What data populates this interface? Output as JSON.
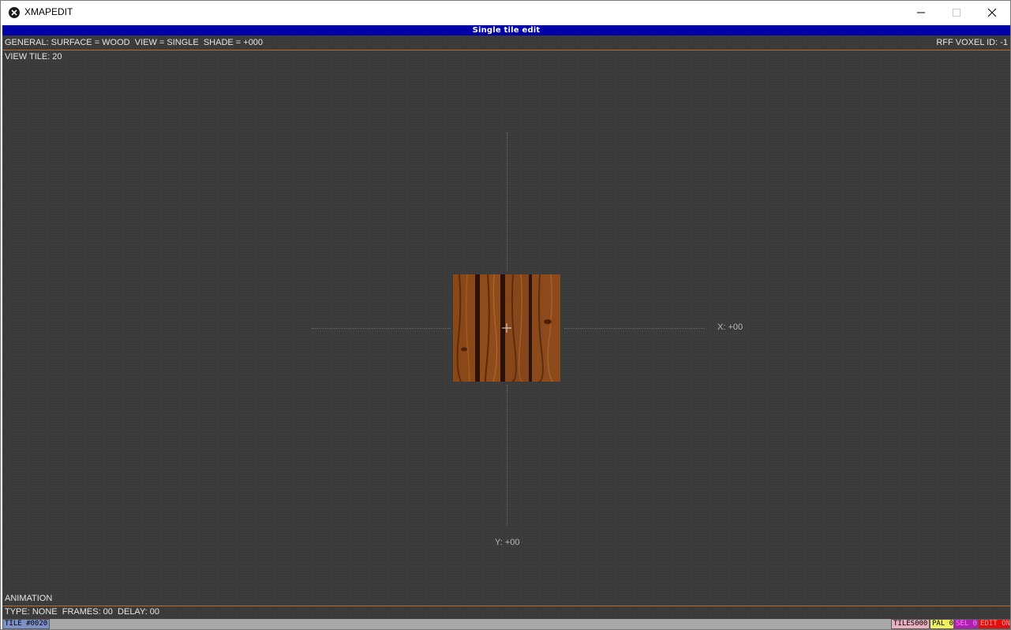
{
  "window": {
    "title": "XMAPEDIT"
  },
  "header": {
    "mode_title": "Single tile edit"
  },
  "info": {
    "general": "GENERAL: SURFACE = WOOD  VIEW = SINGLE  SHADE = +000",
    "voxel": "RFF VOXEL ID: -1",
    "view_tile": "VIEW TILE: 20"
  },
  "viewer": {
    "x_label": "X: +00",
    "y_label": "Y: +00",
    "tile_texture": "wood-planks"
  },
  "animation": {
    "heading": "ANIMATION",
    "details": "TYPE: NONE  FRAMES: 00  DELAY: 00"
  },
  "statusbar": {
    "tile": "TILE #0020",
    "tiles": "TILES000",
    "pal": "PAL 0",
    "sel": "SEL 0",
    "edit": "EDIT ON"
  },
  "colors": {
    "header_bg": "#0000a8",
    "accent_rule": "#c46a2a",
    "tiles_bg": "#e8b0c0",
    "pal_bg": "#f0f060",
    "sel_bg": "#b020b0",
    "edit_bg": "#e01010"
  }
}
